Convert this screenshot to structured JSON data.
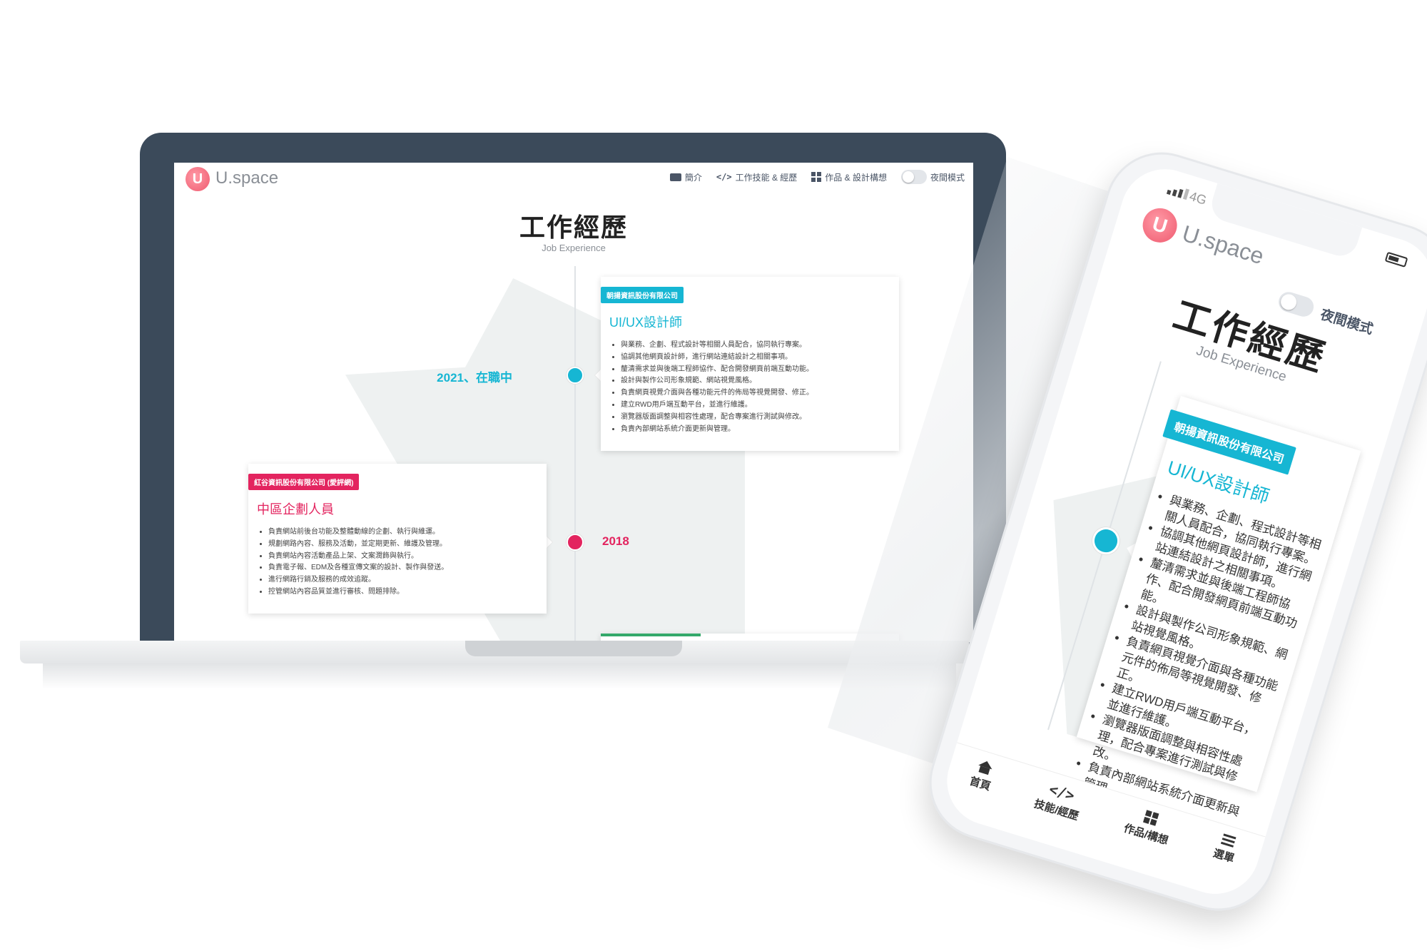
{
  "laptop": {
    "nav": {
      "logo_letter": "U",
      "logo_text": "U.space",
      "menu": [
        {
          "label": "簡介",
          "icon": "id-card-icon"
        },
        {
          "label": "工作技能 & 經歷",
          "icon": "code-icon"
        },
        {
          "label": "作品 & 設計構想",
          "icon": "grid-icon"
        }
      ],
      "night_mode_label": "夜間模式"
    },
    "title": "工作經歷",
    "subtitle": "Job Experience",
    "timeline": [
      {
        "period": "2021、在職中",
        "company": "朝揚資訊股份有限公司",
        "role": "UI/UX設計師",
        "duties": [
          "與業務、企劃、程式設計等相關人員配合，協同執行專案。",
          "協調其他網頁設計師，進行網站連結設計之相關事項。",
          "釐清需求並與後端工程師協作、配合開發網頁前端互動功能。",
          "設計與製作公司形象規範、網站視覺風格。",
          "負責網頁視覺介面與各種功能元件的佈局等視覺開發、修正。",
          "建立RWD用戶端互動平台，並進行維護。",
          "瀏覽器版面調整與相容性處理，配合專案進行測試與修改。",
          "負責內部網站系統介面更新與管理。"
        ]
      },
      {
        "period": "2018",
        "company": "紅谷資訊股份有限公司 (愛評網)",
        "role": "中區企劃人員",
        "duties": [
          "負責網站前後台功能及整體動線的企劃、執行與維運。",
          "規劃網路內容、服務及活動，並定期更新、維護及管理。",
          "負責網站內容活動產品上架、文案潤飾與執行。",
          "負責電子報、EDM及各種宣傳文案的設計、製作與發送。",
          "進行網路行銷及服務的成效追蹤。",
          "控管網站內容品質並進行審核、問題排除。"
        ]
      }
    ],
    "colors": {
      "accent_cyan": "#16b6d3",
      "accent_pink": "#e3245f",
      "frame": "#3b4a5a"
    }
  },
  "phone": {
    "status": {
      "network": "4G"
    },
    "logo_letter": "U",
    "logo_text": "U.space",
    "night_mode_label": "夜間模式",
    "title": "工作經歷",
    "subtitle": "Job Experience",
    "card": {
      "company": "朝揚資訊股份有限公司",
      "role": "UI/UX設計師",
      "duties": [
        "與業務、企劃、程式設計等相關人員配合，協同執行專案。",
        "協調其他網頁設計師，進行網站連結設計之相關事項。",
        "釐清需求並與後端工程師協作、配合開發網頁前端互動功能。",
        "設計與製作公司形象規範、網站視覺風格。",
        "負責網頁視覺介面與各種功能元件的佈局等視覺開發、修正。",
        "建立RWD用戶端互動平台，並進行維護。",
        "瀏覽器版面調整與相容性處理，配合專案進行測試與修改。",
        "負責內部網站系統介面更新與管理。"
      ]
    },
    "tabs": [
      {
        "label": "首頁",
        "icon": "home-icon"
      },
      {
        "label": "技能/經歷",
        "icon": "code-icon"
      },
      {
        "label": "作品/構想",
        "icon": "grid-icon"
      },
      {
        "label": "選單",
        "icon": "menu-icon"
      }
    ]
  }
}
